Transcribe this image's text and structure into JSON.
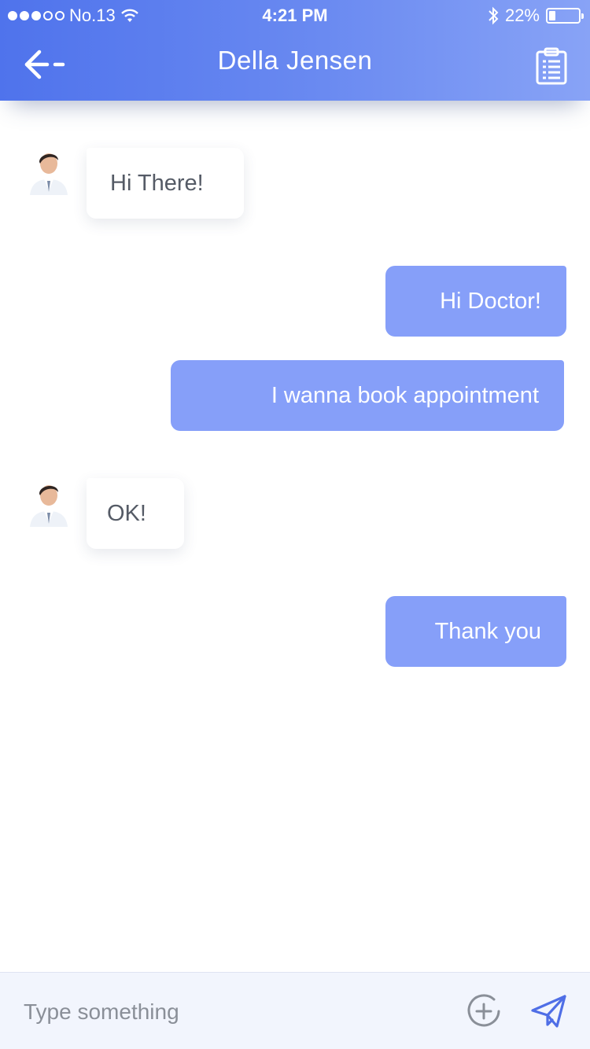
{
  "status_bar": {
    "carrier": "No.13",
    "time": "4:21 PM",
    "battery_percent": "22%",
    "battery_level": 0.22,
    "signal_bars_filled": 3,
    "signal_bars_total": 5
  },
  "header": {
    "title": "Della Jensen",
    "back_icon": "arrow-left-icon",
    "action_icon": "clipboard-icon"
  },
  "colors": {
    "accent": "#5b7bef",
    "outgoing_bubble": "#869ff9",
    "incoming_text": "#555b66"
  },
  "messages": [
    {
      "direction": "incoming",
      "text": "Hi There!"
    },
    {
      "direction": "outgoing",
      "text": "Hi Doctor!"
    },
    {
      "direction": "outgoing",
      "text": "I wanna book appointment"
    },
    {
      "direction": "incoming",
      "text": "OK!"
    },
    {
      "direction": "outgoing",
      "text": "Thank you"
    }
  ],
  "composer": {
    "placeholder": "Type something",
    "add_icon": "plus-circle-icon",
    "send_icon": "paper-plane-icon"
  }
}
